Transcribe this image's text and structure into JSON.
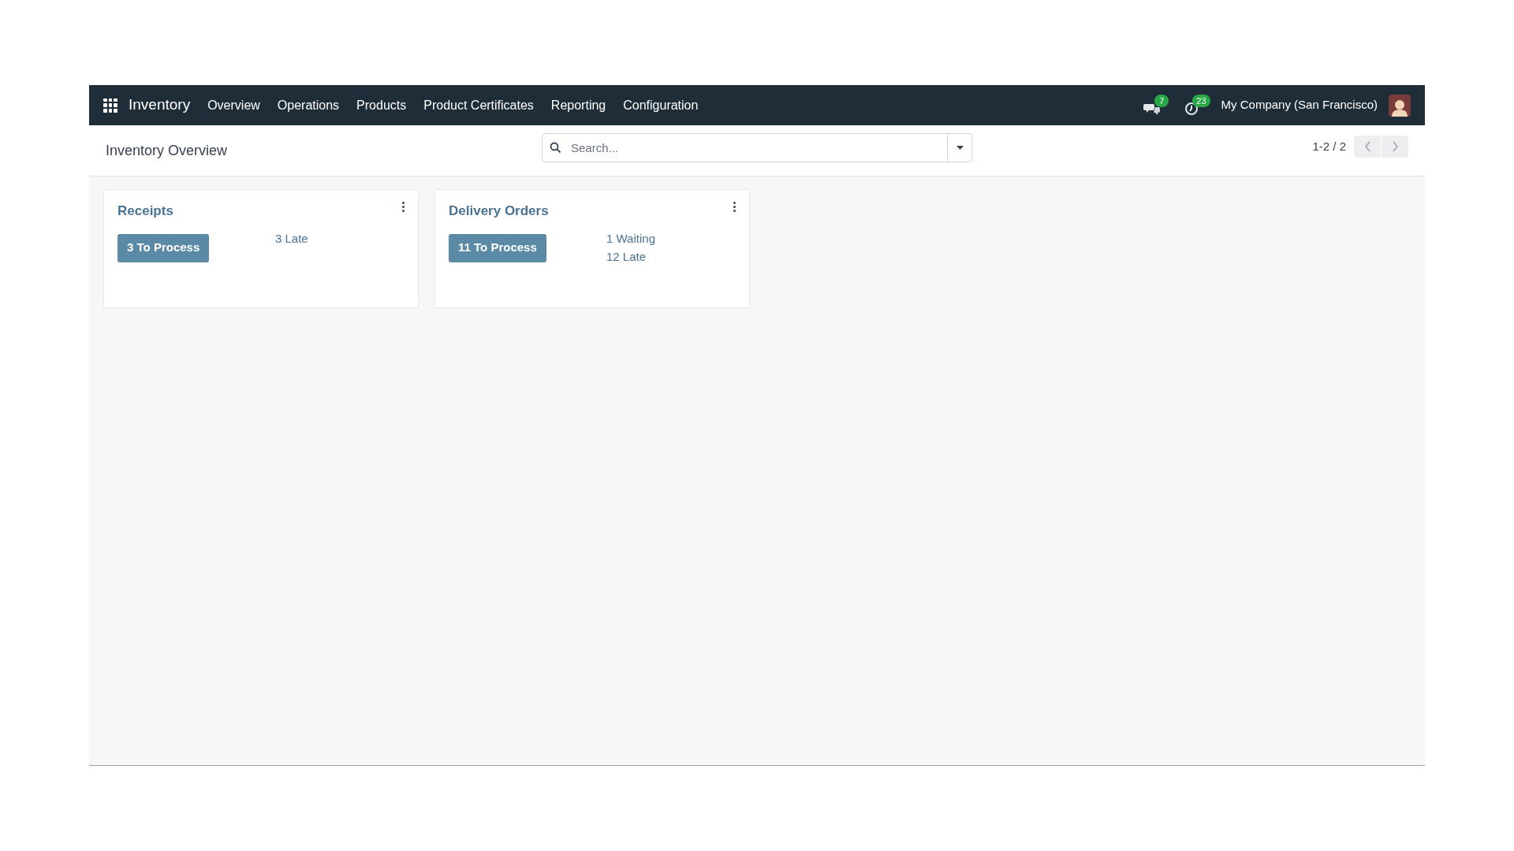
{
  "navbar": {
    "app_name": "Inventory",
    "menu": [
      "Overview",
      "Operations",
      "Products",
      "Product Certificates",
      "Reporting",
      "Configuration"
    ],
    "messages_count": "7",
    "activities_count": "23",
    "company": "My Company (San Francisco)"
  },
  "control_panel": {
    "title": "Inventory Overview",
    "search": {
      "placeholder": "Search..."
    },
    "pager": "1-2 / 2"
  },
  "cards": [
    {
      "title": "Receipts",
      "button": "3 To Process",
      "links": [
        "3 Late"
      ]
    },
    {
      "title": "Delivery Orders",
      "button": "11 To Process",
      "links": [
        "1 Waiting",
        "12 Late"
      ]
    }
  ]
}
